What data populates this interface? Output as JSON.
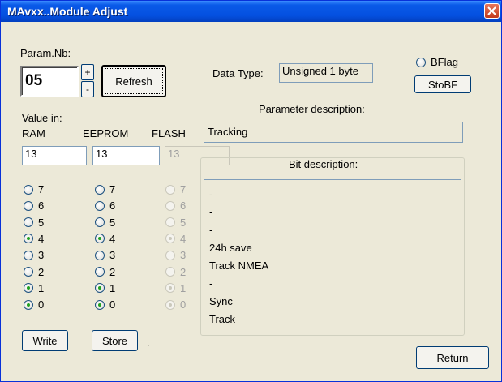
{
  "window": {
    "title": "MAvxx..Module Adjust"
  },
  "param": {
    "label": "Param.Nb:",
    "value": "05",
    "up": "+",
    "down": "-"
  },
  "buttons": {
    "refresh": "Refresh",
    "stobf": "StoBF",
    "write": "Write",
    "store": "Store",
    "return": "Return"
  },
  "datatype": {
    "label": "Data Type:",
    "value": "Unsigned 1 byte"
  },
  "bflag": {
    "label": "BFlag",
    "checked": false
  },
  "param_desc": {
    "label": "Parameter description:",
    "value": "Tracking"
  },
  "value_in": {
    "label": "Value in:",
    "columns": [
      {
        "name": "RAM",
        "value": "13"
      },
      {
        "name": "EEPROM",
        "value": "13"
      },
      {
        "name": "FLASH",
        "value": "13"
      }
    ]
  },
  "bits": [
    {
      "bit": "7",
      "ram": false,
      "eeprom": false,
      "flash": false
    },
    {
      "bit": "6",
      "ram": false,
      "eeprom": false,
      "flash": false
    },
    {
      "bit": "5",
      "ram": false,
      "eeprom": false,
      "flash": false
    },
    {
      "bit": "4",
      "ram": true,
      "eeprom": true,
      "flash": true
    },
    {
      "bit": "3",
      "ram": false,
      "eeprom": false,
      "flash": false
    },
    {
      "bit": "2",
      "ram": false,
      "eeprom": false,
      "flash": false
    },
    {
      "bit": "1",
      "ram": true,
      "eeprom": true,
      "flash": true
    },
    {
      "bit": "0",
      "ram": true,
      "eeprom": true,
      "flash": true
    }
  ],
  "bit_desc": {
    "label": "Bit description:",
    "lines": [
      "-",
      "-",
      "-",
      "24h save",
      "Track NMEA",
      "-",
      "Sync",
      "Track"
    ]
  },
  "status_text": "."
}
